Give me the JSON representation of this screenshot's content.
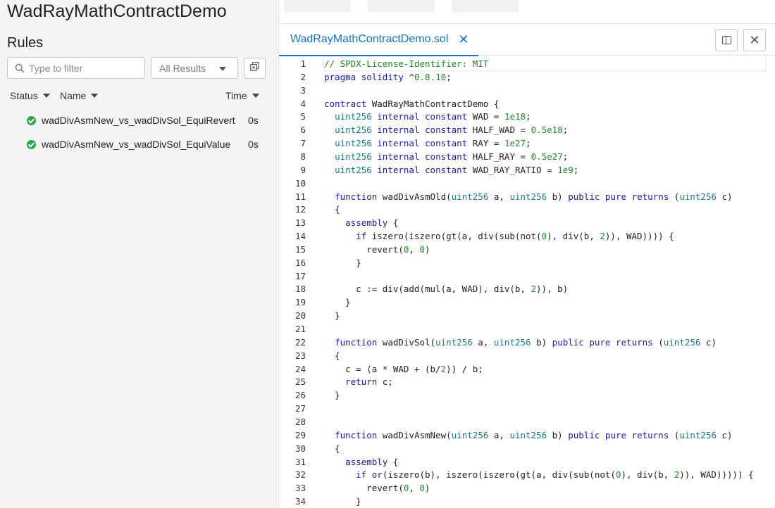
{
  "app": {
    "title": "WadRayMathContractDemo"
  },
  "rules_panel": {
    "title": "Rules",
    "filter": {
      "placeholder": "Type to filter",
      "value": ""
    },
    "results_select": {
      "selected": "All Results"
    },
    "columns": {
      "status": "Status",
      "name": "Name",
      "time": "Time"
    },
    "rules": [
      {
        "status": "passed",
        "name": "wadDivAsmNew_vs_wadDivSol_EquiRevert",
        "time": "0s"
      },
      {
        "status": "passed",
        "name": "wadDivAsmNew_vs_wadDivSol_EquiValue",
        "time": "0s"
      }
    ]
  },
  "editor": {
    "tab": {
      "label": "WadRayMathContractDemo.sol"
    },
    "colors": {
      "keyword": "#1a1ab4",
      "type": "#1a7a8a",
      "comment": "#1f8a2a",
      "accent": "#1a73c8",
      "success": "#2ea44f"
    },
    "lines": [
      "// SPDX-License-Identifier: MIT",
      "pragma solidity ^0.8.10;",
      "",
      "contract WadRayMathContractDemo {",
      "  uint256 internal constant WAD = 1e18;",
      "  uint256 internal constant HALF_WAD = 0.5e18;",
      "  uint256 internal constant RAY = 1e27;",
      "  uint256 internal constant HALF_RAY = 0.5e27;",
      "  uint256 internal constant WAD_RAY_RATIO = 1e9;",
      "",
      "  function wadDivAsmOld(uint256 a, uint256 b) public pure returns (uint256 c)",
      "  {",
      "    assembly {",
      "      if iszero(iszero(gt(a, div(sub(not(0), div(b, 2)), WAD)))) {",
      "        revert(0, 0)",
      "      }",
      "",
      "      c := div(add(mul(a, WAD), div(b, 2)), b)",
      "    }",
      "  }",
      "",
      "  function wadDivSol(uint256 a, uint256 b) public pure returns (uint256 c)",
      "  {",
      "    c = (a * WAD + (b/2)) / b;",
      "    return c;",
      "  }",
      "",
      "",
      "  function wadDivAsmNew(uint256 a, uint256 b) public pure returns (uint256 c)",
      "  {",
      "    assembly {",
      "      if or(iszero(b), iszero(iszero(gt(a, div(sub(not(0), div(b, 2)), WAD))))) {",
      "        revert(0, 0)",
      "      }"
    ]
  }
}
